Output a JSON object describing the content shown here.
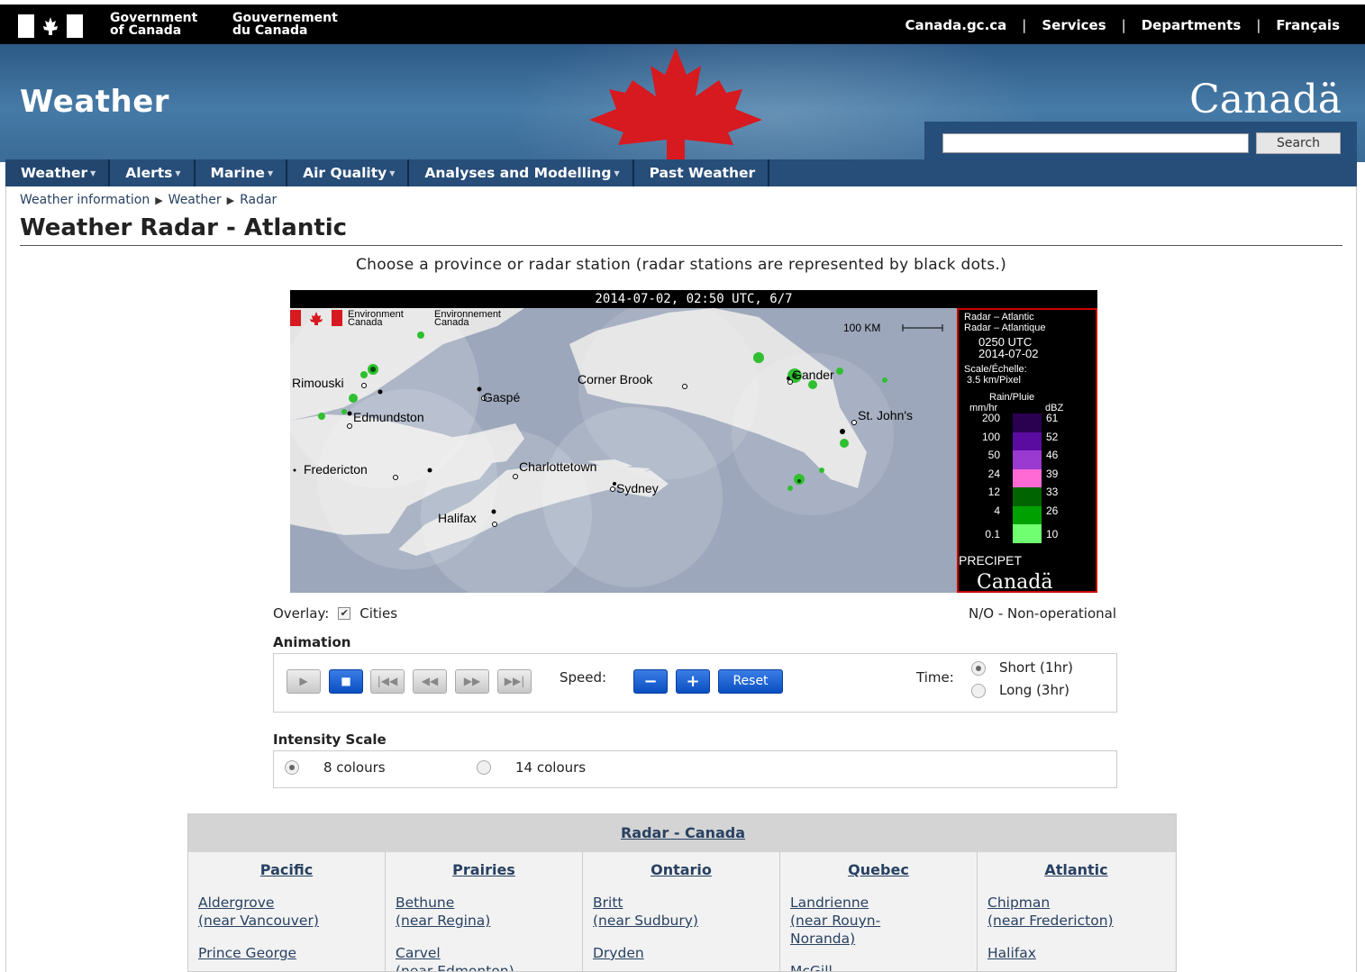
{
  "fip": {
    "gov_en_1": "Government",
    "gov_en_2": "of Canada",
    "gov_fr_1": "Gouvernement",
    "gov_fr_2": "du Canada",
    "links": [
      "Canada.gc.ca",
      "Services",
      "Departments",
      "Français"
    ]
  },
  "banner": {
    "site_title": "Weather",
    "wordmark": "Canadä",
    "search_button": "Search",
    "search_value": ""
  },
  "nav": {
    "items": [
      "Weather",
      "Alerts",
      "Marine",
      "Air Quality",
      "Analyses and Modelling",
      "Past Weather"
    ]
  },
  "breadcrumb": [
    "Weather information",
    "Weather",
    "Radar"
  ],
  "page": {
    "title": "Weather Radar - Atlantic",
    "intro": "Choose a province or radar station (radar stations are represented by black dots.)"
  },
  "radar": {
    "timestamp": "2014-07-02, 02:50 UTC, 6/7",
    "env_en": "Environment",
    "env_en2": "Canada",
    "env_fr": "Environnement",
    "env_fr2": "Canada",
    "scale_bar": "100 KM",
    "cities": [
      "Rimouski",
      "Gaspé",
      "Corner Brook",
      "Gander",
      "St. John's",
      "Edmundston",
      "Fredericton",
      "Charlottetown",
      "Sydney",
      "Halifax"
    ],
    "legend": {
      "l1": "Radar – Atlantic",
      "l2": "Radar – Atlantique",
      "time": "0250 UTC",
      "date": "2014-07-02",
      "scale1": "Scale/Échelle:",
      "scale2": "3.5 km/Pixel",
      "rain": "Rain/Pluie",
      "mmhr": "mm/hr",
      "dbz": "dBZ",
      "mm_values": [
        "200",
        "100",
        "50",
        "24",
        "12",
        "4",
        "0.1"
      ],
      "dbz_values": [
        "61",
        "52",
        "46",
        "39",
        "33",
        "26",
        "10"
      ],
      "colors": [
        "#2a0050",
        "#5a0ca0",
        "#9a3ad0",
        "#ff6ad5",
        "#006400",
        "#00a000",
        "#70ff70"
      ],
      "product": "PRECIPET",
      "wordmark": "Canadä"
    }
  },
  "controls": {
    "overlay_label": "Overlay:",
    "overlay_cities": "Cities",
    "overlay_checked": true,
    "non_operational": "N/O - Non-operational",
    "animation_label": "Animation",
    "speed_label": "Speed:",
    "reset_label": "Reset",
    "time_label": "Time:",
    "time_options": [
      "Short (1hr)",
      "Long (3hr)"
    ],
    "time_selected": "Short (1hr)",
    "intensity_label": "Intensity Scale",
    "intensity_options": [
      "8 colours",
      "14 colours"
    ],
    "intensity_selected": "8 colours"
  },
  "radar_canada": {
    "title": "Radar - Canada",
    "columns": [
      {
        "region": "Pacific",
        "items": [
          "Aldergrove",
          "(near Vancouver)",
          "Prince George"
        ]
      },
      {
        "region": "Prairies",
        "items": [
          "Bethune",
          "(near Regina)",
          "Carvel",
          "(near Edmonton)"
        ]
      },
      {
        "region": "Ontario",
        "items": [
          "Britt",
          "(near Sudbury)",
          "Dryden"
        ]
      },
      {
        "region": "Quebec",
        "items": [
          "Landrienne",
          "(near Rouyn-",
          "Noranda)",
          "McGill"
        ]
      },
      {
        "region": "Atlantic",
        "items": [
          "Chipman",
          "(near Fredericton)",
          "Halifax"
        ]
      }
    ]
  }
}
